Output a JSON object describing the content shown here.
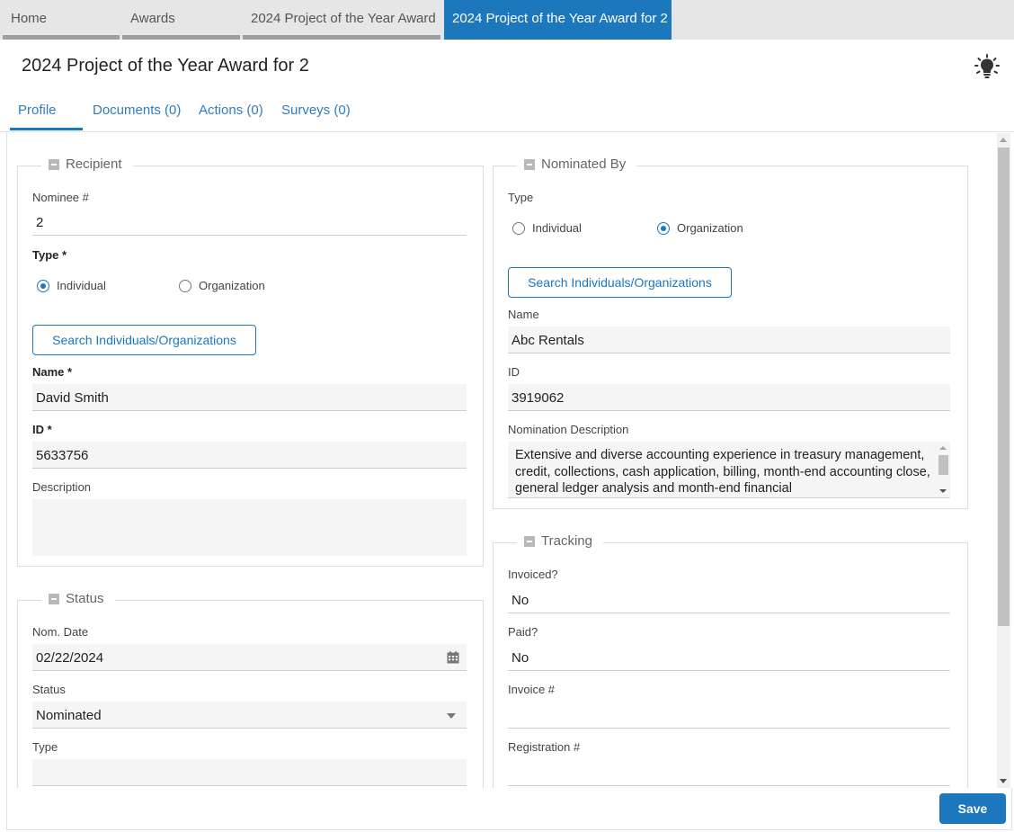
{
  "breadcrumbs": [
    {
      "label": "Home"
    },
    {
      "label": "Awards"
    },
    {
      "label": "2024 Project of the Year Award"
    },
    {
      "label": "2024 Project of the Year Award for 2"
    }
  ],
  "page_title": "2024 Project of the Year Award for 2",
  "tabs": [
    {
      "label": "Profile"
    },
    {
      "label": "Documents (0)"
    },
    {
      "label": "Actions (0)"
    },
    {
      "label": "Surveys (0)"
    }
  ],
  "recipient": {
    "legend": "Recipient",
    "nominee_label": "Nominee #",
    "nominee_value": "2",
    "type_label": "Type *",
    "type_options": [
      "Individual",
      "Organization"
    ],
    "type_selected": "Individual",
    "search_button": "Search Individuals/Organizations",
    "name_label": "Name *",
    "name_value": "David Smith",
    "id_label": "ID *",
    "id_value": "5633756",
    "description_label": "Description",
    "description_value": ""
  },
  "status": {
    "legend": "Status",
    "nom_date_label": "Nom. Date",
    "nom_date_value": "02/22/2024",
    "status_label": "Status",
    "status_value": "Nominated",
    "type_label": "Type",
    "type_value": ""
  },
  "nominated_by": {
    "legend": "Nominated By",
    "type_label": "Type",
    "type_options": [
      "Individual",
      "Organization"
    ],
    "type_selected": "Organization",
    "search_button": "Search Individuals/Organizations",
    "name_label": "Name",
    "name_value": "Abc Rentals",
    "id_label": "ID",
    "id_value": "3919062",
    "description_label": "Nomination Description",
    "description_value": "Extensive and diverse accounting experience in treasury management, credit, collections, cash application, billing, month-end accounting close, general ledger analysis and month-end financial"
  },
  "tracking": {
    "legend": "Tracking",
    "invoiced_label": "Invoiced?",
    "invoiced_value": "No",
    "paid_label": "Paid?",
    "paid_value": "No",
    "invoice_label": "Invoice #",
    "invoice_value": "",
    "registration_label": "Registration #",
    "registration_value": ""
  },
  "save_label": "Save",
  "colors": {
    "accent": "#1d77bd",
    "field_bg": "#f5f5f5"
  },
  "icons": {
    "header": "lightbulb-icon",
    "date": "calendar-icon",
    "collapse": "collapse-icon"
  }
}
